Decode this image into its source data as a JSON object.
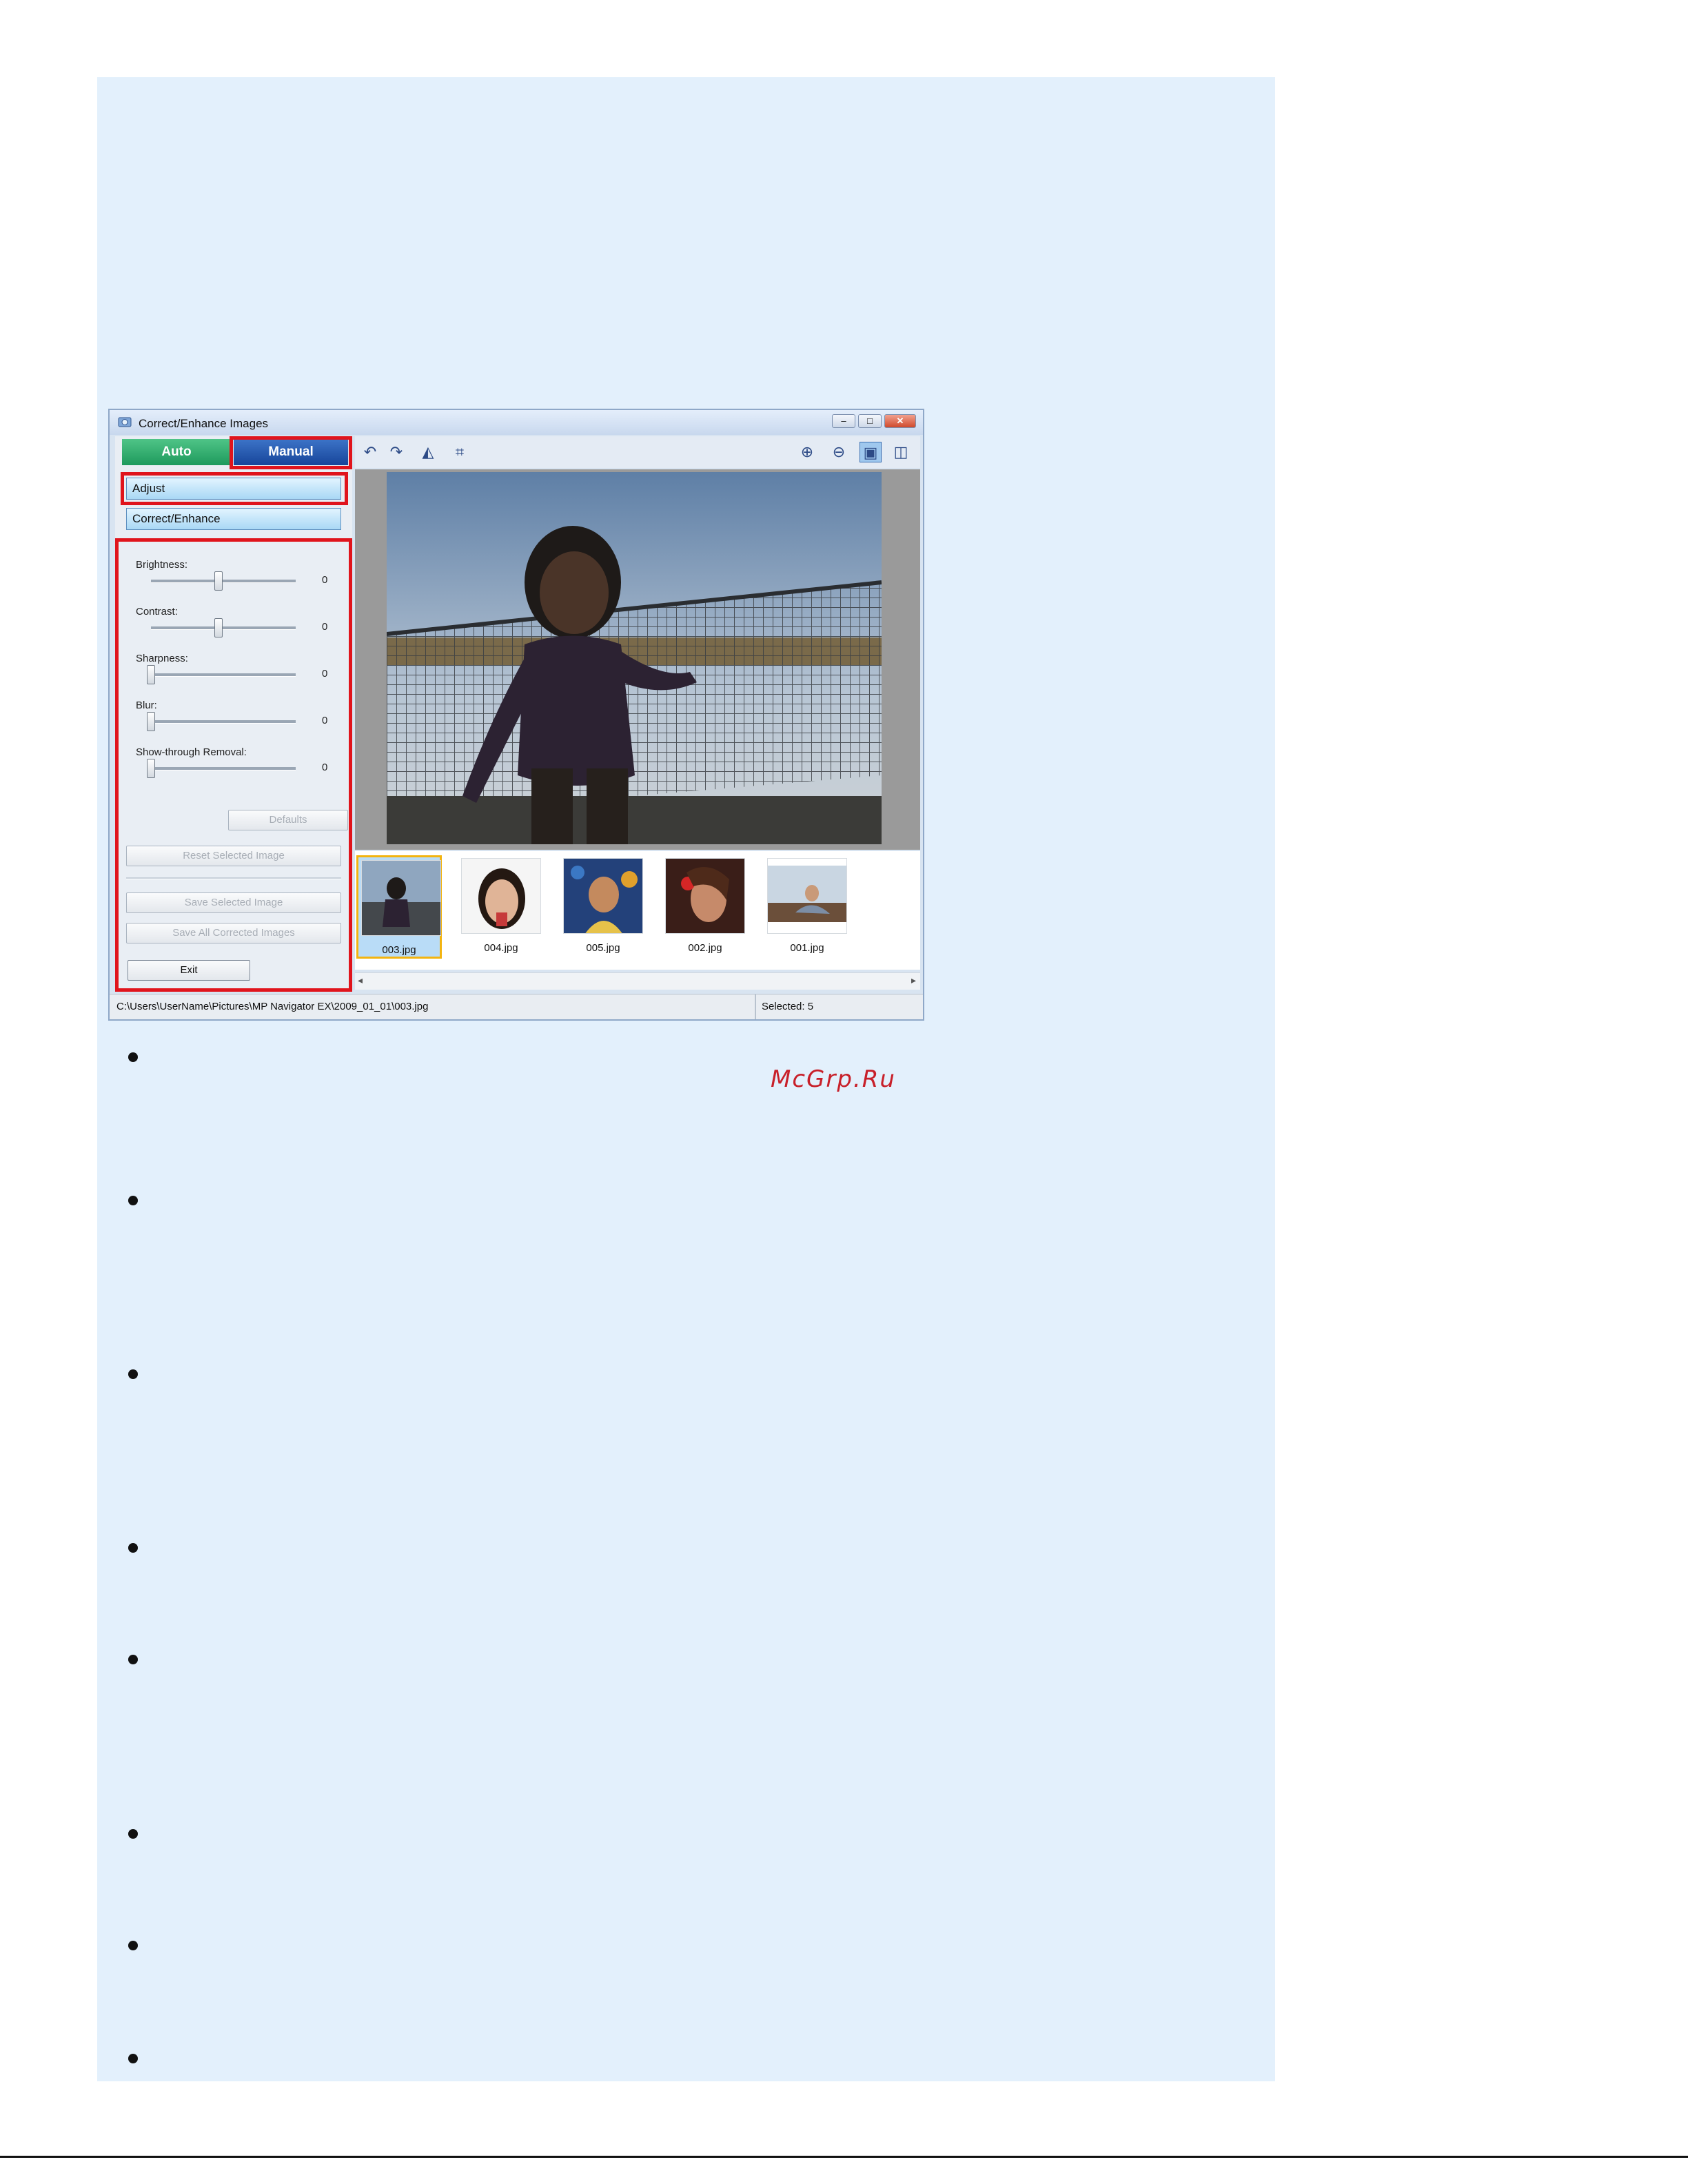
{
  "window": {
    "title": "Correct/Enhance Images",
    "controls": {
      "minimize": "–",
      "maximize": "□",
      "close": "✕"
    }
  },
  "tabs": {
    "auto": "Auto",
    "manual": "Manual"
  },
  "modes": {
    "adjust": "Adjust",
    "correct": "Correct/Enhance"
  },
  "sliders": [
    {
      "label": "Brightness:",
      "value": "0"
    },
    {
      "label": "Contrast:",
      "value": "0"
    },
    {
      "label": "Sharpness:",
      "value": "0"
    },
    {
      "label": "Blur:",
      "value": "0"
    },
    {
      "label": "Show-through Removal:",
      "value": "0"
    }
  ],
  "buttons": {
    "defaults": "Defaults",
    "reset": "Reset Selected Image",
    "save_selected": "Save Selected Image",
    "save_all": "Save All Corrected Images",
    "exit": "Exit"
  },
  "toolbar": {
    "rotate_left_icon": "rotate-left-icon",
    "rotate_right_icon": "rotate-right-icon",
    "mirror_icon": "mirror-icon",
    "crop_icon": "crop-icon",
    "zoom_in_icon": "zoom-in-icon",
    "zoom_out_icon": "zoom-out-icon",
    "whole_image_icon": "whole-image-icon",
    "compare_icon": "compare-icon"
  },
  "thumbnails": [
    {
      "caption": "003.jpg",
      "selected": true
    },
    {
      "caption": "004.jpg",
      "selected": false
    },
    {
      "caption": "005.jpg",
      "selected": false
    },
    {
      "caption": "002.jpg",
      "selected": false
    },
    {
      "caption": "001.jpg",
      "selected": false
    }
  ],
  "status": {
    "path": "C:\\Users\\UserName\\Pictures\\MP Navigator EX\\2009_01_01\\003.jpg",
    "selected": "Selected: 5"
  },
  "watermark": "McGrp.Ru",
  "colors": {
    "panel_bg": "#e3f0fc",
    "highlight": "#e0141c",
    "auto_tab": "#1e9a5c",
    "manual_tab": "#17459a"
  }
}
